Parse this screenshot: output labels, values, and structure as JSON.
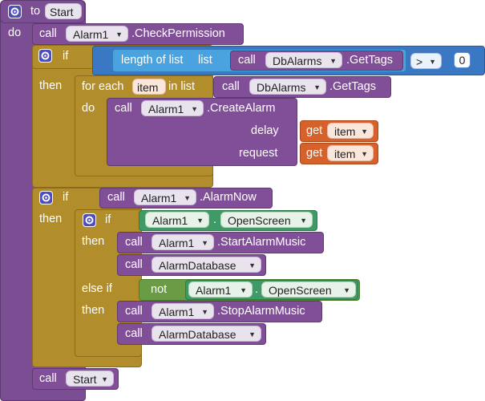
{
  "procedure": {
    "to_label": "to",
    "name": "Start",
    "do_label": "do"
  },
  "keywords": {
    "call": "call",
    "if": "if",
    "then": "then",
    "else_if": "else if",
    "do": "do",
    "for_each": "for each",
    "in_list": "in list",
    "get": "get",
    "not": "not",
    "length_of_list": "length of list",
    "list": "list",
    "dot": "."
  },
  "blocks": {
    "check_permission": {
      "component": "Alarm1",
      "method": ".CheckPermission"
    },
    "get_tags_1": {
      "component": "DbAlarms",
      "method": ".GetTags"
    },
    "compare": {
      "operator": ">",
      "value": "0"
    },
    "loop_var": "item",
    "get_tags_2": {
      "component": "DbAlarms",
      "method": ".GetTags"
    },
    "create_alarm": {
      "component": "Alarm1",
      "method": ".CreateAlarm",
      "delay_label": "delay",
      "request_label": "request",
      "delay_value": "item",
      "request_value": "item"
    },
    "alarm_now": {
      "component": "Alarm1",
      "method": ".AlarmNow"
    },
    "open_screen_1": {
      "component": "Alarm1",
      "property": "OpenScreen"
    },
    "start_music": {
      "component": "Alarm1",
      "method": ".StartAlarmMusic"
    },
    "alarm_db_1": {
      "procedure": "AlarmDatabase"
    },
    "open_screen_2": {
      "component": "Alarm1",
      "property": "OpenScreen"
    },
    "stop_music": {
      "component": "Alarm1",
      "method": ".StopAlarmMusic"
    },
    "alarm_db_2": {
      "procedure": "AlarmDatabase"
    },
    "call_start": {
      "procedure": "Start"
    }
  },
  "colors": {
    "procedure": "#7b4e94",
    "control": "#b28d2c",
    "math": "#3b78c4",
    "list": "#4aa3df",
    "variable": "#d6612a",
    "component": "#3f9a67",
    "logic": "#6a9c45"
  }
}
